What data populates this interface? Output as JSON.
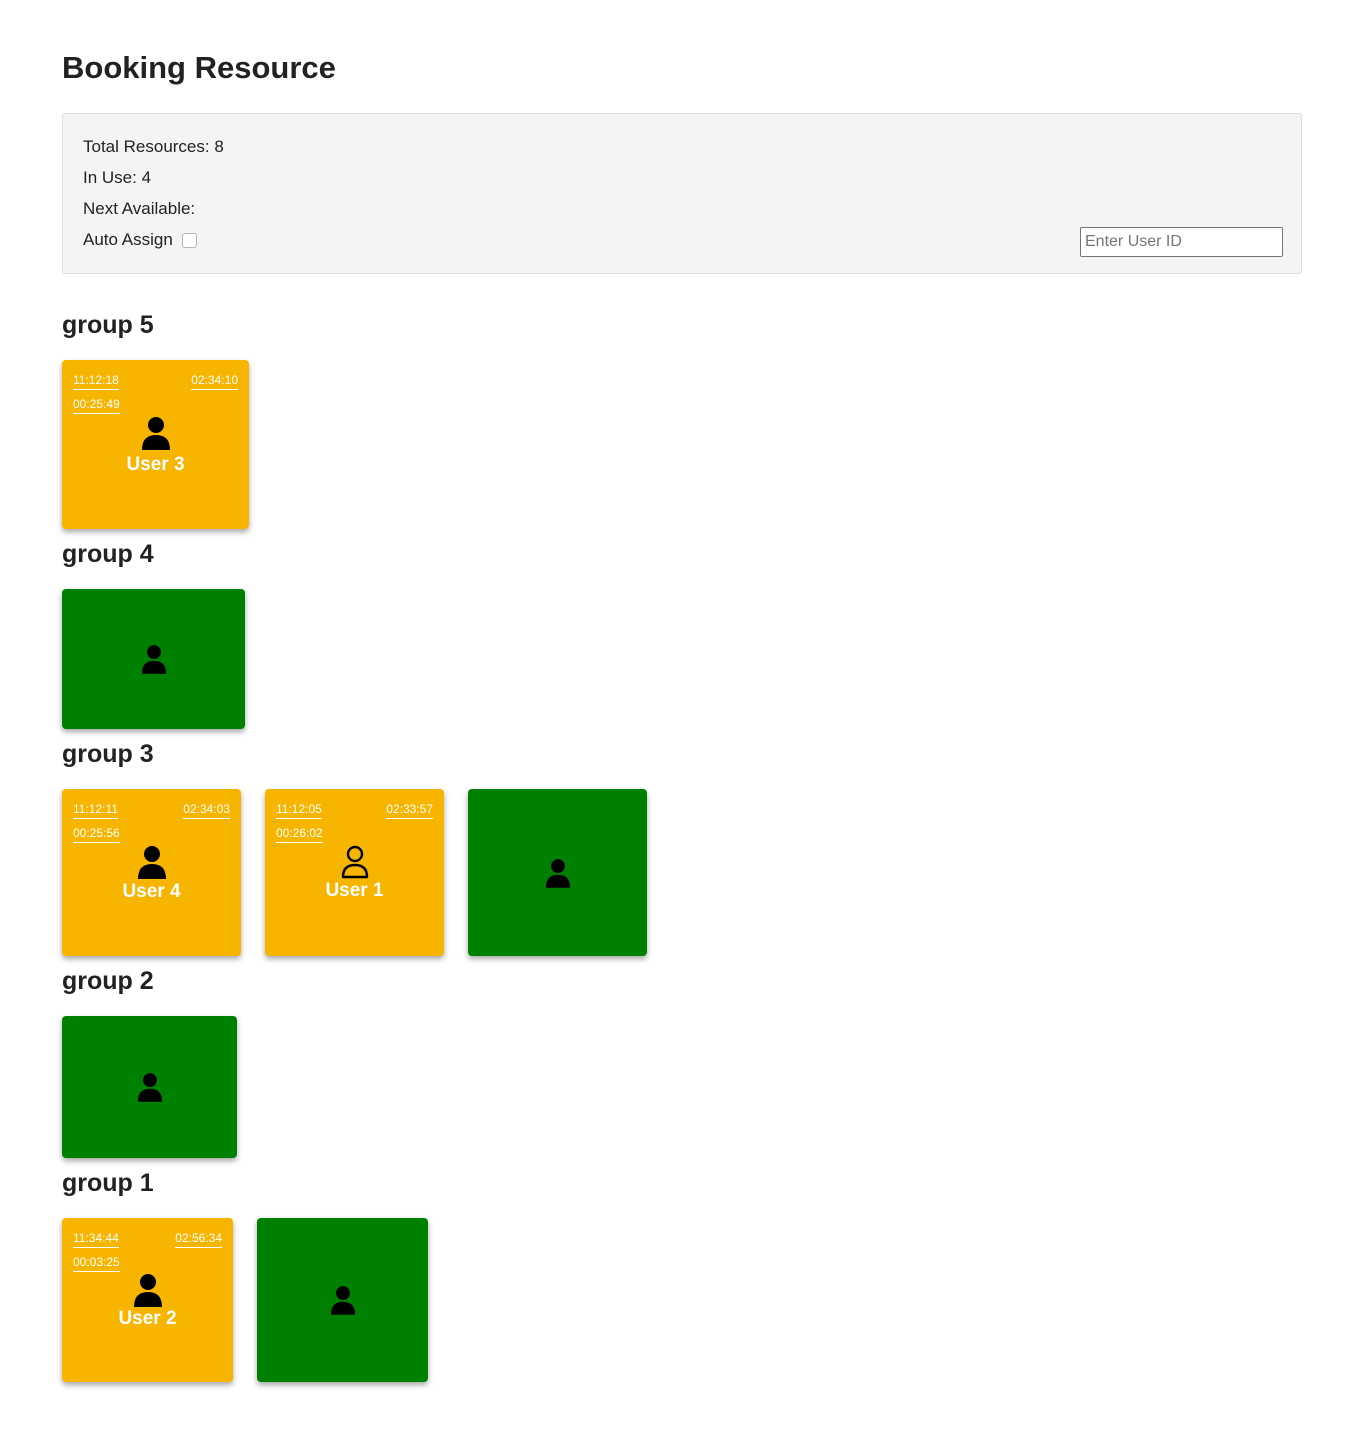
{
  "page": {
    "title": "Booking Resource"
  },
  "summary": {
    "total_label": "Total Resources: 8",
    "inuse_label": "In Use: 4",
    "next_label": "Next Available:",
    "auto_assign_label": "Auto Assign",
    "auto_assign_checked": false,
    "user_input_placeholder": "Enter User ID",
    "user_input_value": ""
  },
  "colors": {
    "busy": "#f7b500",
    "free": "#008000"
  },
  "groups": [
    {
      "name": "group 5",
      "resources": [
        {
          "status": "busy",
          "icon": "user-solid-icon",
          "start": "11:12:18",
          "end": "02:34:10",
          "elapsed": "00:25:49",
          "user": "User 3"
        }
      ]
    },
    {
      "name": "group 4",
      "resources": [
        {
          "status": "free",
          "icon": "user-solid-icon"
        }
      ]
    },
    {
      "name": "group 3",
      "resources": [
        {
          "status": "busy",
          "icon": "user-solid-icon",
          "start": "11:12:11",
          "end": "02:34:03",
          "elapsed": "00:25:56",
          "user": "User 4"
        },
        {
          "status": "busy",
          "icon": "user-outline-icon",
          "start": "11:12:05",
          "end": "02:33:57",
          "elapsed": "00:26:02",
          "user": "User 1"
        },
        {
          "status": "free",
          "icon": "user-solid-icon"
        }
      ]
    },
    {
      "name": "group 2",
      "resources": [
        {
          "status": "free",
          "icon": "user-solid-icon"
        }
      ]
    },
    {
      "name": "group 1",
      "resources": [
        {
          "status": "busy",
          "icon": "user-solid-icon",
          "start": "11:34:44",
          "end": "02:56:34",
          "elapsed": "00:03:25",
          "user": "User 2"
        },
        {
          "status": "free",
          "icon": "user-solid-icon"
        }
      ]
    }
  ]
}
